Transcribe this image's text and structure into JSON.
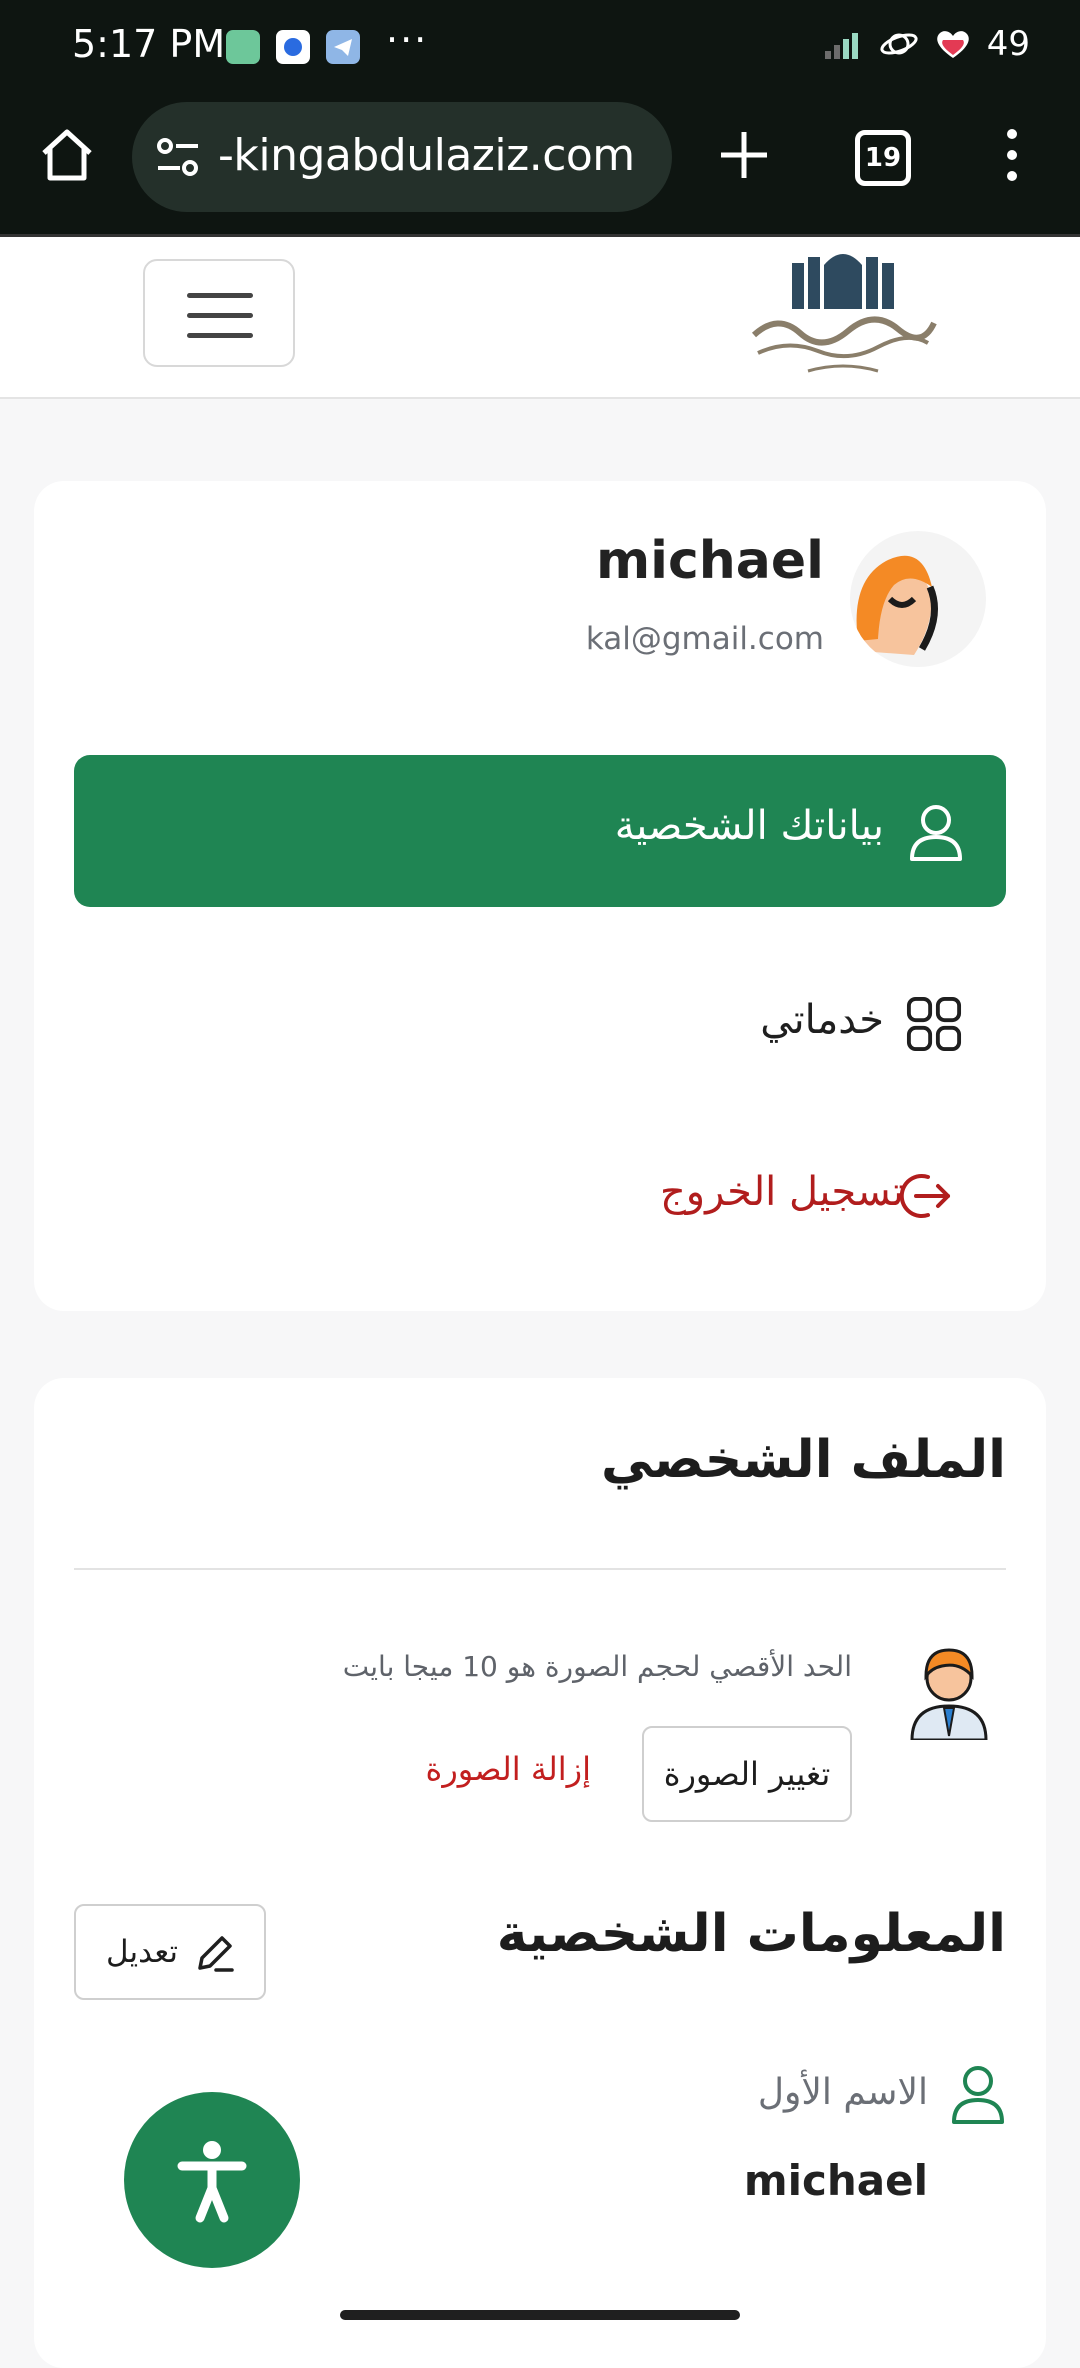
{
  "status_bar": {
    "time": "5:17 PM",
    "overflow": "···",
    "battery": "49"
  },
  "browser": {
    "url": "-kingabdulaziz.com",
    "tab_count": "19"
  },
  "profile_card": {
    "name": "michael",
    "email": "kal@gmail.com",
    "nav": {
      "personal_data": "بياناتك الشخصية",
      "services": "خدماتي",
      "logout": "تسجيل الخروج"
    }
  },
  "profile_section": {
    "title": "الملف الشخصي",
    "photo_note": "الحد الأقصي لحجم الصورة هو 10 ميجا بايت",
    "change_photo": "تغيير الصورة",
    "remove_photo": "إزالة الصورة"
  },
  "personal_info": {
    "title": "المعلومات الشخصية",
    "edit": "تعديل",
    "first_name_label": "الاسم الأول",
    "first_name_value": "michael"
  },
  "colors": {
    "primary_green": "#1f8553",
    "danger_red": "#c21f1f"
  },
  "icons": {
    "home": "home-icon",
    "site_settings": "tune-icon",
    "new_tab": "plus-icon",
    "tabs": "tab-switcher-icon",
    "menu": "kebab-menu-icon",
    "user": "user-icon",
    "grid": "grid-icon",
    "logout": "logout-icon",
    "edit": "pencil-icon",
    "accessibility": "accessibility-icon"
  }
}
